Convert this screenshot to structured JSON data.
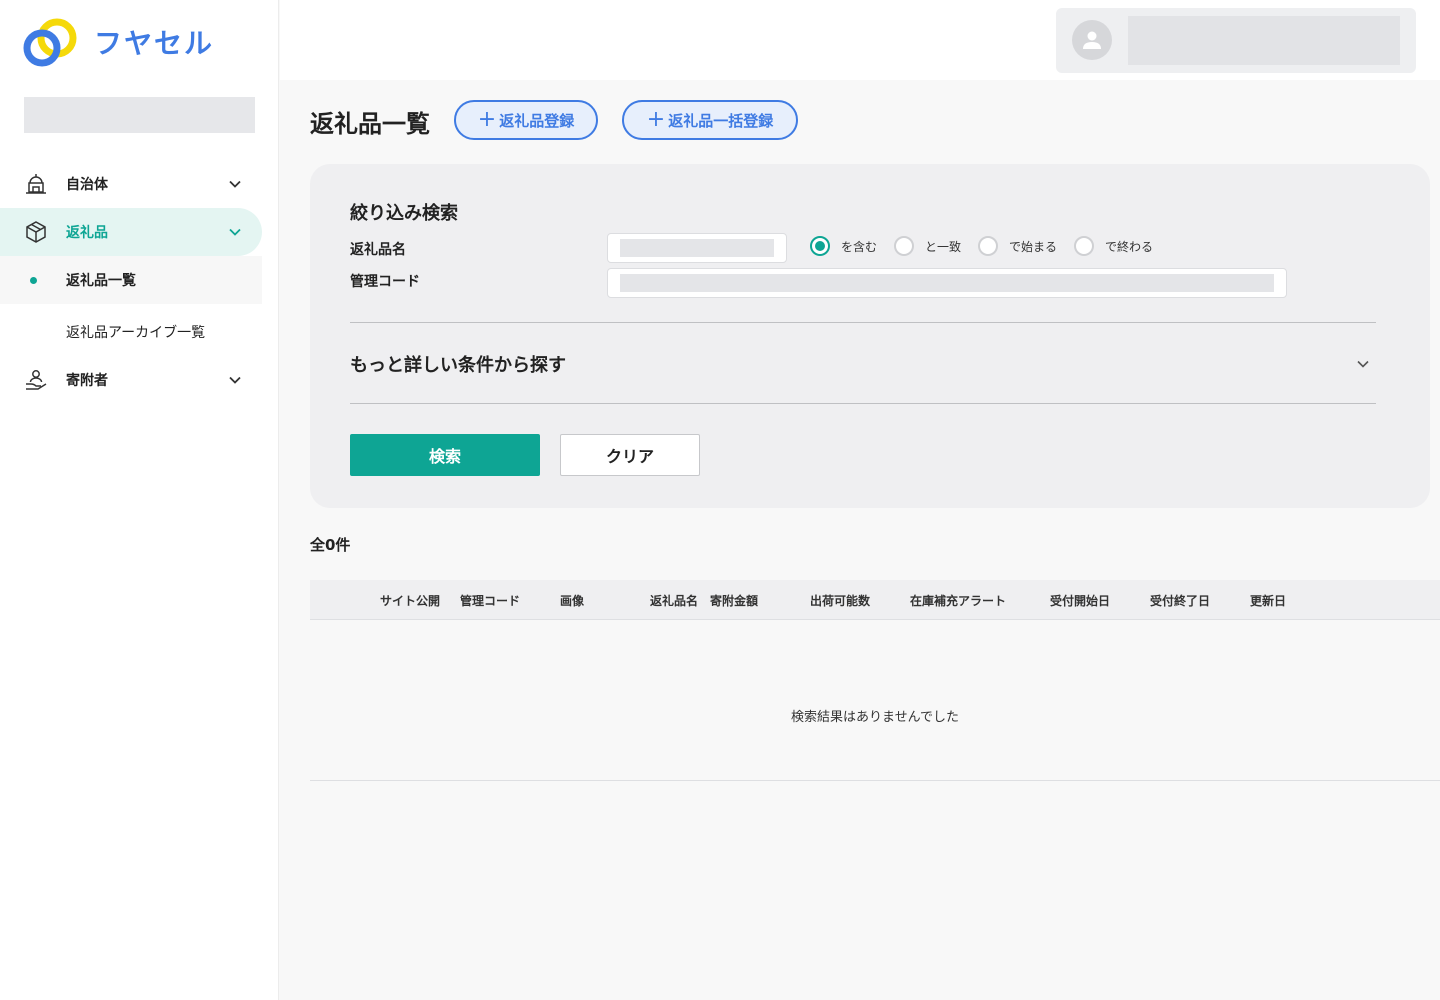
{
  "brand": {
    "name": "フヤセル",
    "primary_color": "#3f7be3",
    "accent_color": "#0ea594"
  },
  "sidebar": {
    "items": [
      {
        "label": "自治体",
        "icon": "city-hall-icon"
      },
      {
        "label": "返礼品",
        "icon": "package-icon",
        "active": true
      },
      {
        "label": "寄附者",
        "icon": "hand-person-icon"
      }
    ],
    "sub_items": [
      {
        "label": "返礼品一覧",
        "current": true
      },
      {
        "label": "返礼品アーカイブ一覧"
      }
    ]
  },
  "header": {
    "user_icon": "user-avatar-icon"
  },
  "page": {
    "title": "返礼品一覧",
    "register_button": "返礼品登録",
    "bulk_register_button": "返礼品一括登録"
  },
  "search": {
    "heading": "絞り込み検索",
    "name_label": "返礼品名",
    "code_label": "管理コード",
    "match_options": [
      "を含む",
      "と一致",
      "で始まる",
      "で終わる"
    ],
    "selected_option": "を含む",
    "advanced_label": "もっと詳しい条件から探す",
    "search_button": "検索",
    "clear_button": "クリア"
  },
  "results": {
    "count_label": "全0件",
    "columns": [
      "サイト公開",
      "管理コード",
      "画像",
      "返礼品名",
      "寄附金額",
      "出荷可能数",
      "在庫補充アラート",
      "受付開始日",
      "受付終了日",
      "更新日"
    ],
    "empty_message": "検索結果はありませんでした"
  }
}
